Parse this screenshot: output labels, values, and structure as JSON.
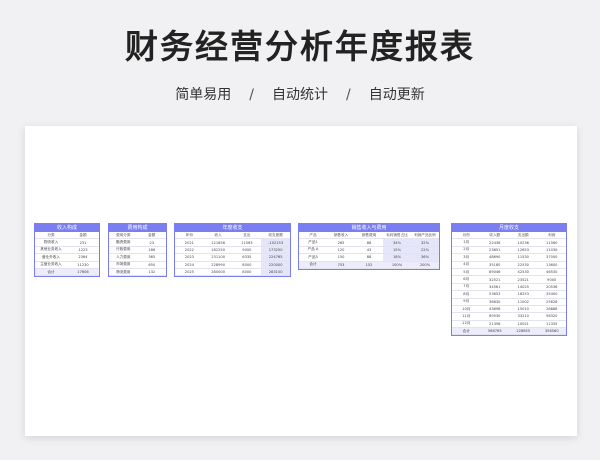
{
  "page": {
    "title": "财务经营分析年度报表",
    "tags": [
      "简单易用",
      "自动统计",
      "自动更新"
    ],
    "separator": "/"
  },
  "tables": {
    "income": {
      "title": "收入构成",
      "headers": [
        "分类",
        "金额"
      ],
      "rows": [
        [
          "物流收入",
          "231"
        ],
        [
          "其他业务收入",
          "1223"
        ],
        [
          "营业外收入",
          "2364"
        ],
        [
          "主营业务收入",
          "11230"
        ],
        [
          "合计",
          "17606"
        ]
      ]
    },
    "expense": {
      "title": "费用构成",
      "headers": [
        "费用分类",
        "金额"
      ],
      "rows": [
        [
          "融资费用",
          "23"
        ],
        [
          "行政费用",
          "186"
        ],
        [
          "人力费用",
          "365"
        ],
        [
          "市场费用",
          "650"
        ],
        [
          "物流费用",
          "132"
        ]
      ]
    },
    "yearly": {
      "title": "年度收支",
      "headers": [
        "年份",
        "收入",
        "支出",
        "收支差额"
      ],
      "rows": [
        [
          "2021",
          "121656",
          "11563",
          "-102153"
        ],
        [
          "2022",
          "182250",
          "9000",
          "173250"
        ],
        [
          "2023",
          "231100",
          "6335",
          "224765"
        ],
        [
          "2024",
          "228990",
          "8000",
          "220000"
        ],
        [
          "2025",
          "280000",
          "8000",
          "283100"
        ]
      ]
    },
    "sales": {
      "title": "销售收入与费用",
      "headers": [
        "产品",
        "销售收入",
        "销售费用",
        "毛利销售占比",
        "利润产品比例"
      ],
      "rows": [
        [
          "产品1",
          "265",
          "86",
          "34%",
          "32%"
        ],
        [
          "产品 A",
          "120",
          "43",
          "15%",
          "22%"
        ],
        [
          "产品3",
          "150",
          "88",
          "18%",
          "36%"
        ],
        [
          "合计",
          "753",
          "152",
          "100%",
          "200%"
        ]
      ]
    },
    "monthly": {
      "title": "月度收支",
      "headers": [
        "月份",
        "收入额",
        "支出额",
        "利润"
      ],
      "rows": [
        [
          "1月",
          "22436",
          "10236",
          "11560"
        ],
        [
          "2月",
          "23651",
          "12653",
          "11030"
        ],
        [
          "3月",
          "48690",
          "11530",
          "37000"
        ],
        [
          "4月",
          "35180",
          "22530",
          "13600"
        ],
        [
          "5月",
          "89046",
          "42530",
          "46530"
        ],
        [
          "6月",
          "32521",
          "23521",
          "9000"
        ],
        [
          "7月",
          "34561",
          "14025",
          "20536"
        ],
        [
          "8月",
          "53653",
          "18253",
          "35400"
        ],
        [
          "9月",
          "36630",
          "11002",
          "25628"
        ],
        [
          "10月",
          "43698",
          "15010",
          "28688"
        ],
        [
          "11月",
          "89530",
          "33210",
          "56320"
        ],
        [
          "12月",
          "21356",
          "10021",
          "11335"
        ],
        [
          "合计",
          "568765",
          "228655",
          "356560"
        ]
      ]
    }
  }
}
